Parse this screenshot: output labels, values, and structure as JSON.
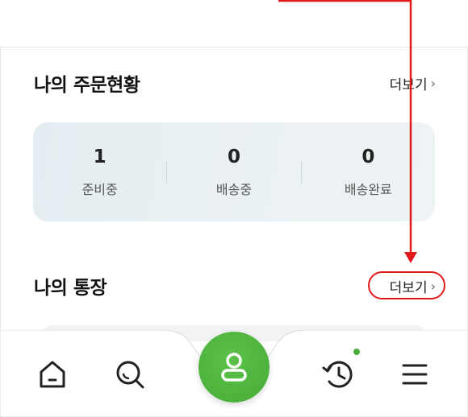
{
  "orders": {
    "title": "나의 주문현황",
    "more_label": "더보기",
    "items": [
      {
        "count": "1",
        "label": "준비중"
      },
      {
        "count": "0",
        "label": "배송중"
      },
      {
        "count": "0",
        "label": "배송완료"
      }
    ]
  },
  "account": {
    "title": "나의 통장",
    "more_label": "더보기"
  },
  "tabbar": {
    "items": [
      {
        "icon": "home-icon"
      },
      {
        "icon": "search-icon"
      },
      {
        "icon": "user-icon"
      },
      {
        "icon": "history-icon"
      },
      {
        "icon": "menu-icon"
      }
    ],
    "accent": "#46ab35",
    "badge_color": "#4aab3c"
  },
  "annotation": {
    "color": "#e01a1a"
  }
}
